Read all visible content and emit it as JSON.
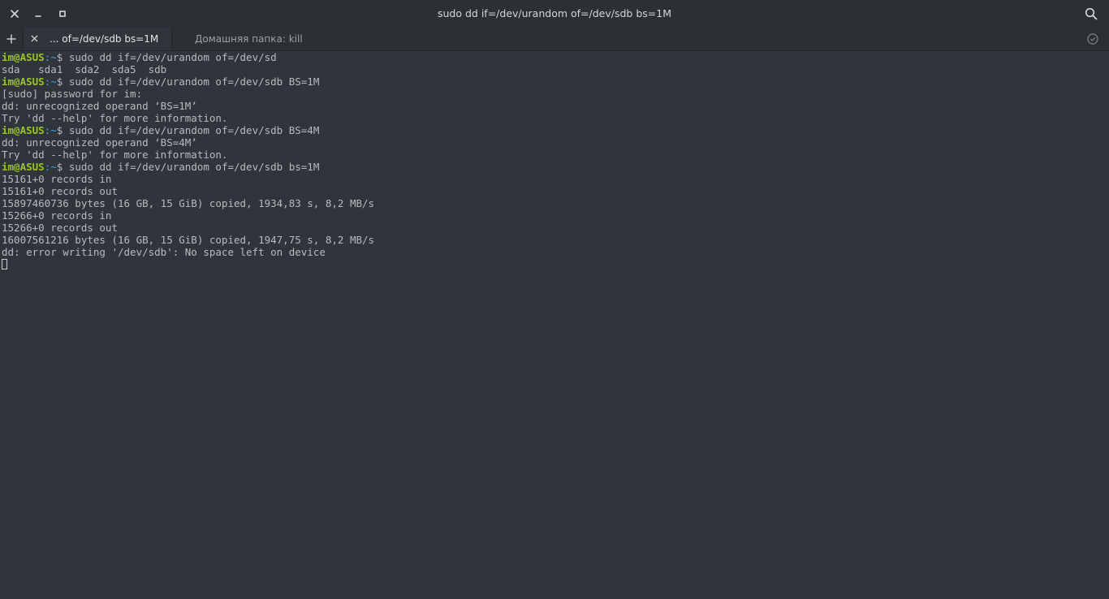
{
  "window": {
    "title": "sudo dd if=/dev/urandom of=/dev/sdb bs=1M",
    "icons": {
      "close": "close-icon",
      "minimize": "minimize-icon",
      "maximize": "maximize-icon",
      "search": "search-icon"
    }
  },
  "tabs": {
    "new_tab_icon": "plus-icon",
    "items": [
      {
        "label": "... of=/dev/sdb bs=1M",
        "active": true,
        "close_icon": "close-icon"
      },
      {
        "label": "Домашняя папка: kill",
        "active": false
      }
    ],
    "history_icon": "clock-icon"
  },
  "terminal": {
    "colors": {
      "background": "#2f353a",
      "foreground": "#b6bbc0",
      "prompt_user": "#9cc22a",
      "prompt_path": "#45a0e0"
    },
    "lines": [
      {
        "type": "prompt",
        "user": "im@ASUS",
        "path": ":~",
        "sym": "$ ",
        "cmd": "sudo dd if=/dev/urandom of=/dev/sd"
      },
      {
        "type": "output",
        "text": "sda   sda1  sda2  sda5  sdb"
      },
      {
        "type": "prompt",
        "user": "im@ASUS",
        "path": ":~",
        "sym": "$ ",
        "cmd": "sudo dd if=/dev/urandom of=/dev/sdb BS=1M"
      },
      {
        "type": "output",
        "text": "[sudo] password for im:"
      },
      {
        "type": "output",
        "text": "dd: unrecognized operand ‘BS=1M’"
      },
      {
        "type": "output",
        "text": "Try 'dd --help' for more information."
      },
      {
        "type": "prompt",
        "user": "im@ASUS",
        "path": ":~",
        "sym": "$ ",
        "cmd": "sudo dd if=/dev/urandom of=/dev/sdb BS=4M"
      },
      {
        "type": "output",
        "text": "dd: unrecognized operand ‘BS=4M’"
      },
      {
        "type": "output",
        "text": "Try 'dd --help' for more information."
      },
      {
        "type": "prompt",
        "user": "im@ASUS",
        "path": ":~",
        "sym": "$ ",
        "cmd": "sudo dd if=/dev/urandom of=/dev/sdb bs=1M"
      },
      {
        "type": "output",
        "text": "15161+0 records in"
      },
      {
        "type": "output",
        "text": "15161+0 records out"
      },
      {
        "type": "output",
        "text": "15897460736 bytes (16 GB, 15 GiB) copied, 1934,83 s, 8,2 MB/s"
      },
      {
        "type": "output",
        "text": "15266+0 records in"
      },
      {
        "type": "output",
        "text": "15266+0 records out"
      },
      {
        "type": "output",
        "text": "16007561216 bytes (16 GB, 15 GiB) copied, 1947,75 s, 8,2 MB/s"
      },
      {
        "type": "output",
        "text": "dd: error writing '/dev/sdb': No space left on device"
      }
    ]
  }
}
